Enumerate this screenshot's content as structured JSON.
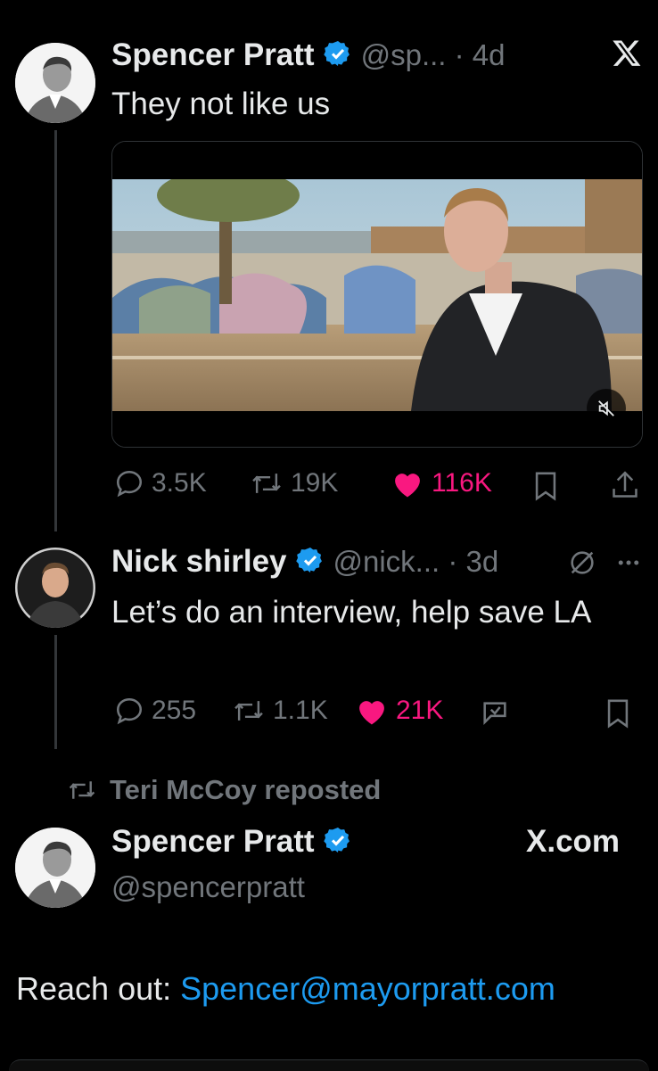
{
  "tweet1": {
    "name": "Spencer Pratt",
    "handle_time": "@sp... · 4d",
    "text": "They not like us",
    "close_glyph": "X",
    "stats": {
      "replies": "3.5K",
      "reposts": "19K",
      "likes": "116K"
    }
  },
  "tweet2": {
    "name": "Nick shirley",
    "handle_time": "@nick... · 3d",
    "text": "Let’s do an interview, help save LA",
    "stats": {
      "replies": "255",
      "reposts": "1.1K",
      "likes": "21K"
    }
  },
  "repost": {
    "text": "Teri McCoy reposted"
  },
  "tweet3": {
    "name": "Spencer Pratt",
    "handle": "@spencerpratt",
    "brand": "X.com",
    "text_prefix": "Reach out: ",
    "email": "Spencer@mayorpratt.com"
  },
  "colors": {
    "background": "#000000",
    "text": "#e7e9ea",
    "muted": "#71767b",
    "like": "#f91880",
    "link": "#1d9bf0",
    "verified": "#1d9bf0"
  }
}
